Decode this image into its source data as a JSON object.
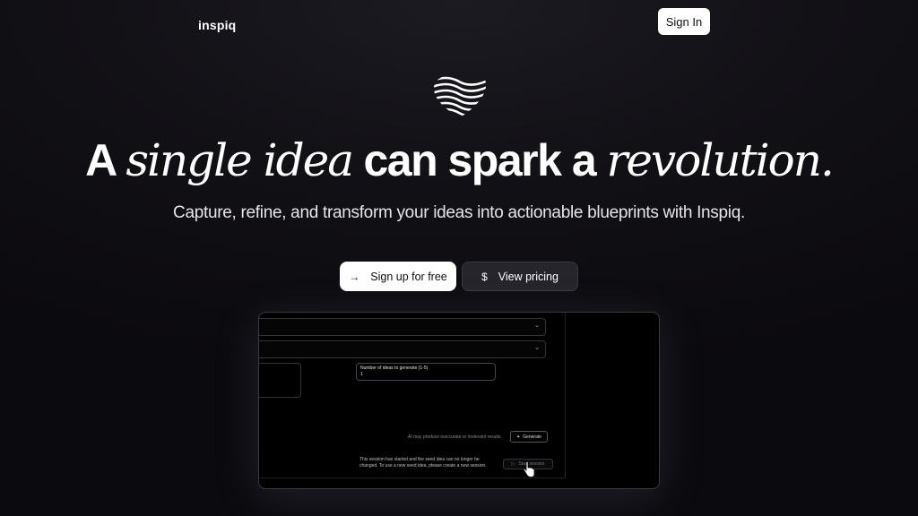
{
  "header": {
    "brand": "inspiq",
    "sign_in_label": "Sign In"
  },
  "logo": {
    "icon": "wave-heart-logo"
  },
  "hero": {
    "title_parts": {
      "a": "A",
      "single_idea": "single idea",
      "can_spark_a": "can spark a",
      "revolution": "revolution."
    },
    "subtitle": "Capture, refine, and transform your ideas into actionable blueprints with Inspiq."
  },
  "cta": {
    "primary": {
      "label": "Sign up for free",
      "icon": "arrow-right-icon"
    },
    "secondary": {
      "label": "View pricing",
      "icon": "dollar-icon"
    }
  },
  "preview": {
    "num_ideas_label": "Number of ideas to generate (1-5)",
    "num_ideas_value": "1",
    "disclaimer": "AI may produce inaccurate or irrelevant results.",
    "generate_label": "Generate",
    "session_note": "This session has started and the seed idea can no longer be changed. To use a new seed idea, please create a new session.",
    "start_label": "Start session"
  },
  "colors": {
    "background": "#0b0a0e",
    "primary_button": "#ffffff",
    "secondary_button": "#26252b"
  }
}
